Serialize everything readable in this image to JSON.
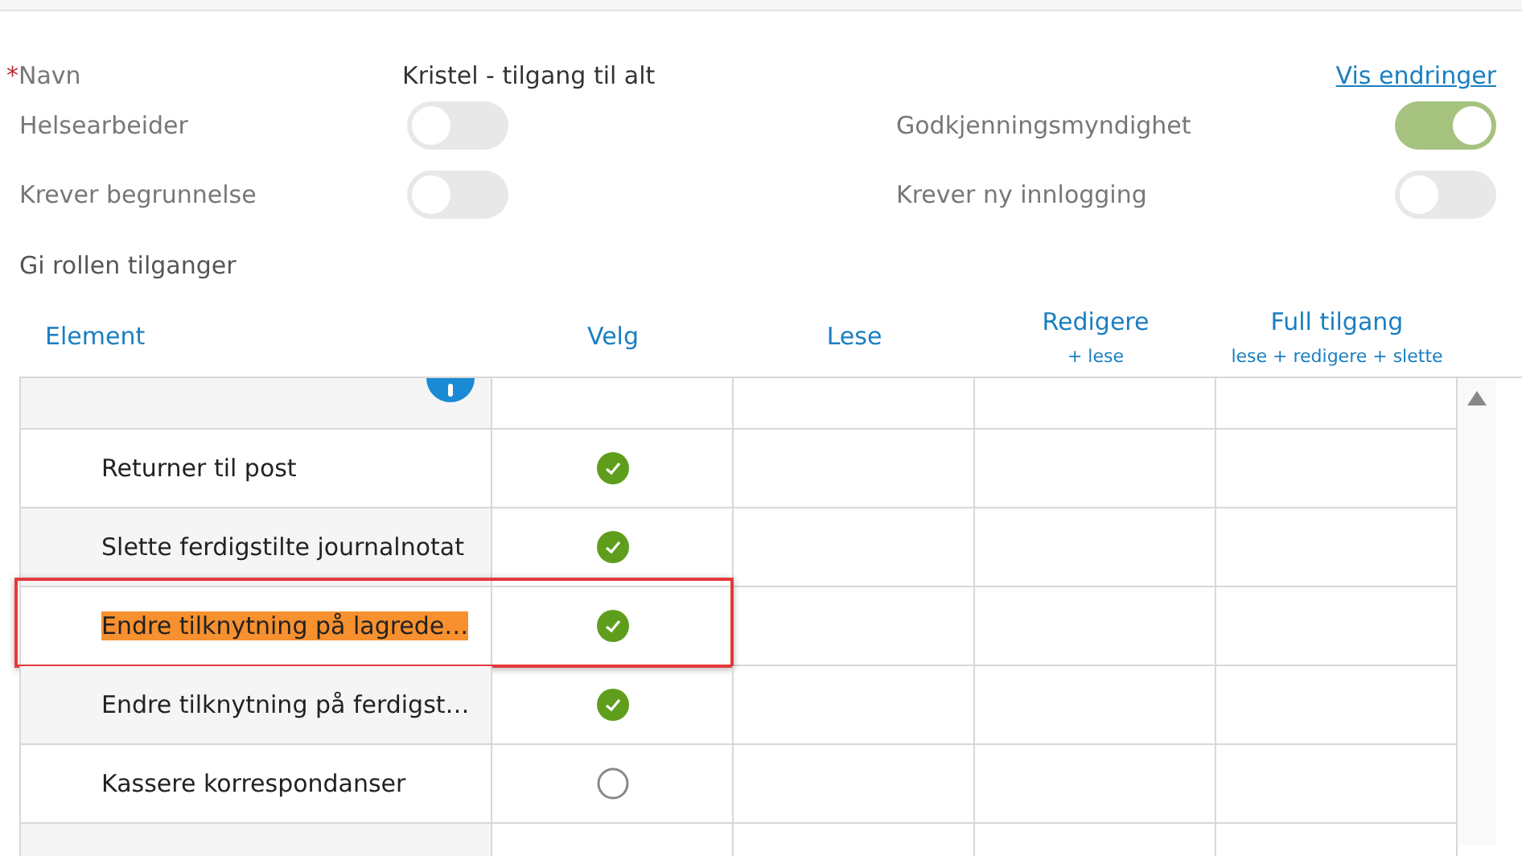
{
  "form": {
    "name_label": "Navn",
    "required_mark": "*",
    "name_value": "Kristel - tilgang til alt",
    "changes_link": "Vis endringer",
    "toggles": [
      {
        "label": "Helsearbeider",
        "on": false
      },
      {
        "label": "Godkjenningsmyndighet",
        "on": true
      },
      {
        "label": "Krever begrunnelse",
        "on": false
      },
      {
        "label": "Krever ny innlogging",
        "on": false
      }
    ],
    "section_label": "Gi rollen tilganger"
  },
  "table": {
    "columns": [
      {
        "label": "Element"
      },
      {
        "label": "Velg"
      },
      {
        "label": "Lese"
      },
      {
        "label": "Redigere",
        "sub": "+ lese"
      },
      {
        "label": "Full tilgang",
        "sub": "lese + redigere + slette"
      }
    ],
    "rows": [
      {
        "kind": "group"
      },
      {
        "kind": "item",
        "label": "Returner til post",
        "checked": true,
        "highlighted": false
      },
      {
        "kind": "item",
        "label": "Slette ferdigstilte journalnotat",
        "checked": true,
        "highlighted": false
      },
      {
        "kind": "item",
        "label": "Endre tilknytning på lagrede…",
        "checked": true,
        "highlighted": true
      },
      {
        "kind": "item",
        "label": "Endre tilknytning på ferdigst…",
        "checked": true,
        "highlighted": false
      },
      {
        "kind": "item",
        "label": "Kassere korrespondanser",
        "checked": false,
        "highlighted": false
      },
      {
        "kind": "empty"
      }
    ]
  }
}
